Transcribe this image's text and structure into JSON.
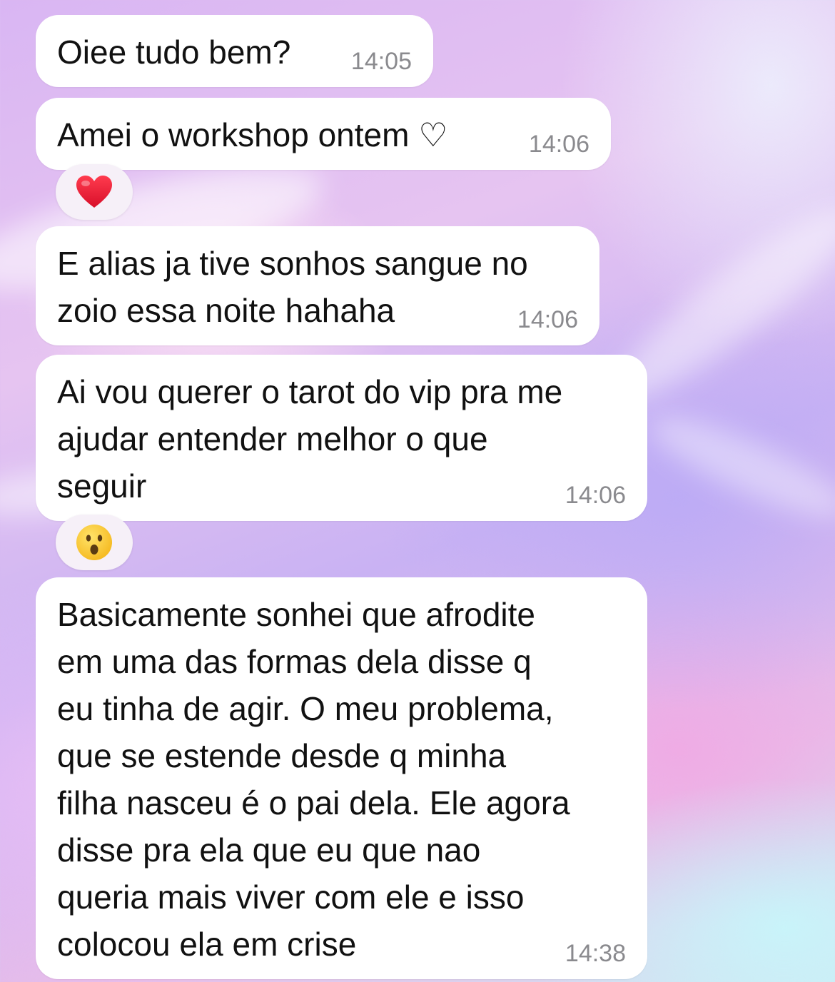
{
  "chat": {
    "messages": [
      {
        "text": "Oiee tudo bem?",
        "time": "14:05"
      },
      {
        "text": "Amei o workshop ontem ♡",
        "time": "14:06",
        "reaction": "red-heart-icon"
      },
      {
        "text": "E alias ja tive sonhos sangue no\nzoio essa noite hahaha",
        "time": "14:06"
      },
      {
        "text": "Ai vou querer o tarot do vip pra me\najudar entender melhor o que\nseguir",
        "time": "14:06",
        "reaction": "surprised-face-icon"
      },
      {
        "text": "Basicamente sonhei que afrodite\nem uma das formas dela disse q\neu tinha de agir. O meu problema,\nque se estende desde q minha\nfilha nasceu é o pai dela. Ele agora\ndisse pra ela que eu que nao\nqueria mais viver com ele e isso\ncolocou ela em crise",
        "time": "14:38"
      }
    ]
  },
  "colors": {
    "bubble": "#ffffff",
    "text": "#111111",
    "timestamp": "#8a8a8e",
    "reaction_pill": "#f6f0f8",
    "heart": "#e8203a",
    "emoji_face": "#f7c232"
  }
}
